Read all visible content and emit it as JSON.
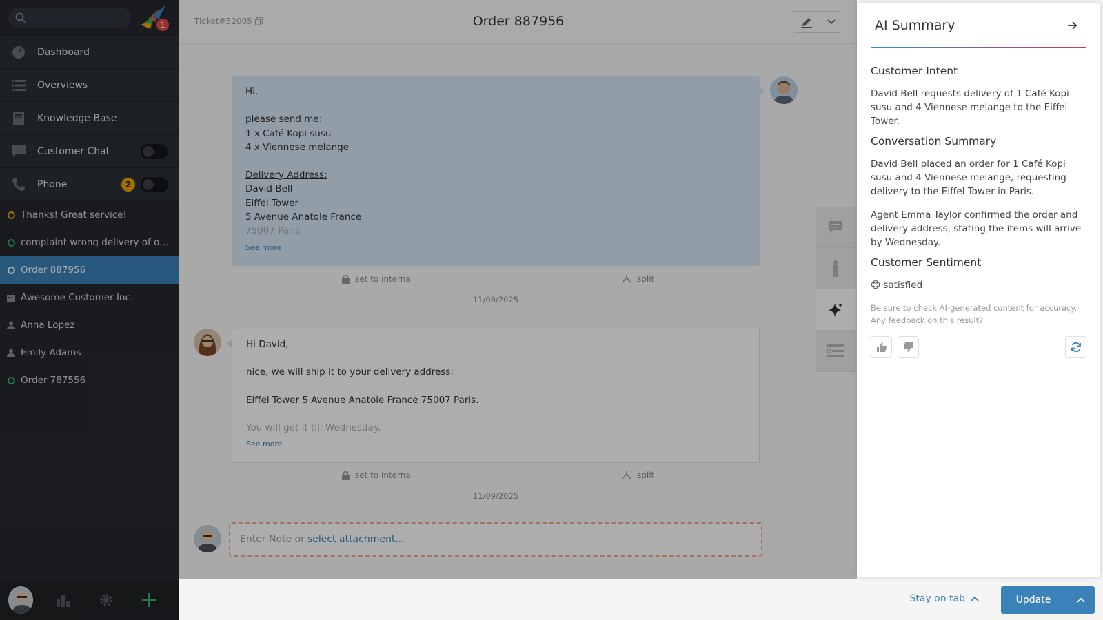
{
  "sidebar": {
    "search": {
      "placeholder": ""
    },
    "logo_badge": "1",
    "nav": [
      {
        "label": "Dashboard",
        "icon": "dashboard-icon"
      },
      {
        "label": "Overviews",
        "icon": "list-icon"
      },
      {
        "label": "Knowledge Base",
        "icon": "book-icon"
      },
      {
        "label": "Customer Chat",
        "icon": "chat-icon"
      },
      {
        "label": "Phone",
        "icon": "phone-icon",
        "badge": "2"
      }
    ],
    "tasks": [
      {
        "label": "Thanks! Great service!",
        "icon": "ticket-open-icon",
        "color": "#f0a500"
      },
      {
        "label": "complaint wrong delivery of order 787556",
        "icon": "ticket-open-icon",
        "color": "#38ad69"
      },
      {
        "label": "Order 887956",
        "icon": "ticket-open-icon",
        "active": true
      },
      {
        "label": "Awesome Customer Inc.",
        "icon": "organization-icon"
      },
      {
        "label": "Anna Lopez",
        "icon": "user-icon"
      },
      {
        "label": "Emily Adams",
        "icon": "user-icon"
      },
      {
        "label": "Order 787556",
        "icon": "ticket-open-icon",
        "color": "#38ad69"
      }
    ]
  },
  "ticket": {
    "number": "Ticket#52005",
    "title": "Order 887956"
  },
  "articles": [
    {
      "lines": [
        "Hi,",
        "please send me:",
        "1 x Café Kopi susu",
        "4 x Viennese melange",
        "Delivery Address:",
        "David Bell",
        "Eiffel Tower",
        "5 Avenue Anatole France",
        "75007 Paris"
      ],
      "see_more": "See more",
      "date": "11/08/2025"
    },
    {
      "lines": [
        "Hi David,",
        "nice, we will ship it to your delivery address:",
        "Eiffel Tower 5 Avenue Anatole France 75007 Paris.",
        "You will get it till Wednesday."
      ],
      "see_more": "See more",
      "date": "11/09/2025"
    }
  ],
  "article_actions": {
    "internal": "set to internal",
    "split": "split"
  },
  "note": {
    "placeholder": "Enter Note or",
    "attach": "select attachment..."
  },
  "ai": {
    "title": "AI Summary",
    "intent_title": "Customer Intent",
    "intent_text": "David Bell requests delivery of 1 Café Kopi susu and 4 Viennese melange to the Eiffel Tower.",
    "summary_title": "Conversation Summary",
    "summary_p1": "David Bell placed an order for 1 Café Kopi susu and 4 Viennese melange, requesting delivery to the Eiffel Tower in Paris.",
    "summary_p2": "Agent Emma Taylor confirmed the order and delivery address, stating the items will arrive by Wednesday.",
    "sentiment_title": "Customer Sentiment",
    "sentiment_emoji": "😊",
    "sentiment_text": "satisfied",
    "disclaimer_1": "Be sure to check AI-generated content for accuracy.",
    "disclaimer_2": "Any feedback on this result?"
  },
  "bottom": {
    "stay_on_tab": "Stay on tab",
    "update": "Update"
  },
  "colors": {
    "accent": "#3b82b8",
    "sidebar_bg": "#26292e",
    "badge_orange": "#f0a500",
    "status_green": "#38ad69"
  }
}
